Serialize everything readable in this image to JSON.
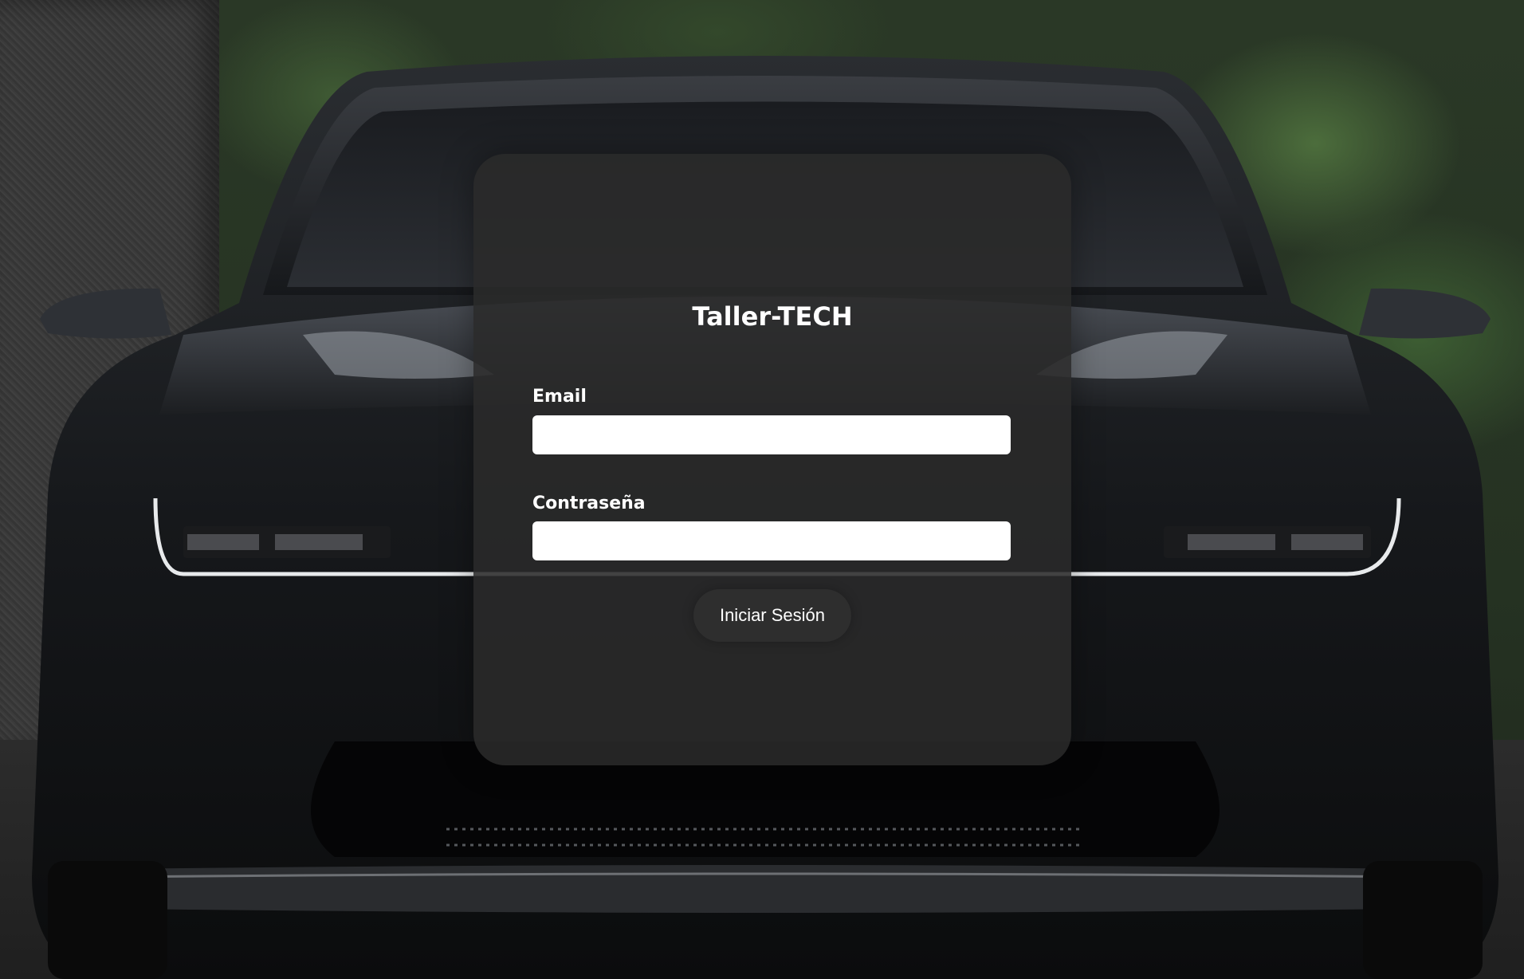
{
  "app": {
    "title": "Taller-TECH"
  },
  "login": {
    "email_label": "Email",
    "email_value": "",
    "password_label": "Contraseña",
    "password_value": "",
    "submit_label": "Iniciar Sesión"
  },
  "colors": {
    "panel": "#2a2a2a",
    "text": "#ffffff",
    "input_bg": "#ffffff"
  }
}
